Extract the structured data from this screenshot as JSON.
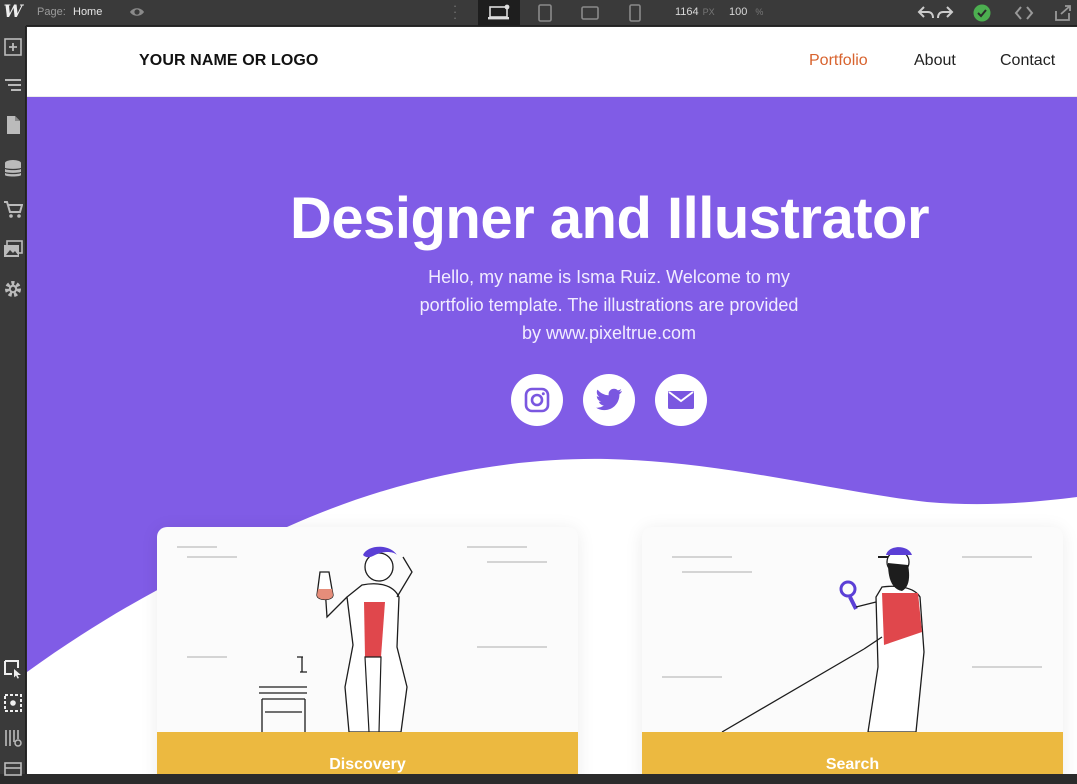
{
  "editor": {
    "logo": "W",
    "page_label": "Page:",
    "page_name": "Home",
    "width_value": "1164",
    "width_unit": "PX",
    "zoom_value": "100",
    "zoom_unit": "%",
    "breakpoints": [
      {
        "icon": "desktop-breakpoint-icon",
        "active": true
      },
      {
        "icon": "tablet-breakpoint-icon",
        "active": false
      },
      {
        "icon": "mobile-landscape-breakpoint-icon",
        "active": false
      },
      {
        "icon": "mobile-portrait-breakpoint-icon",
        "active": false
      }
    ],
    "left_tools": [
      "add-panel-icon",
      "navigator-icon",
      "pages-icon",
      "cms-icon",
      "ecommerce-icon",
      "assets-icon",
      "settings-icon"
    ],
    "bottom_tools": [
      "select-tool-icon",
      "preview-tool-icon",
      "grid-overlay-icon",
      "audit-icon"
    ],
    "status_color": "#4caf50"
  },
  "site": {
    "brand": "YOUR NAME OR LOGO",
    "nav": [
      {
        "label": "Portfolio",
        "active": true
      },
      {
        "label": "About",
        "active": false
      },
      {
        "label": "Contact",
        "active": false
      }
    ],
    "hero": {
      "title": "Designer and Illustrator",
      "intro_line1": "Hello, my name is Isma Ruiz. Welcome to my",
      "intro_line2": "portfolio template. The illustrations are provided",
      "intro_line3": "by www.pixeltrue.com",
      "background": "#805ce6"
    },
    "social": [
      "instagram-icon",
      "twitter-icon",
      "email-icon"
    ],
    "cards": [
      {
        "label": "Discovery",
        "color": "#ecb940"
      },
      {
        "label": "Search",
        "color": "#ecb940"
      }
    ],
    "accent": "#d8632e"
  }
}
